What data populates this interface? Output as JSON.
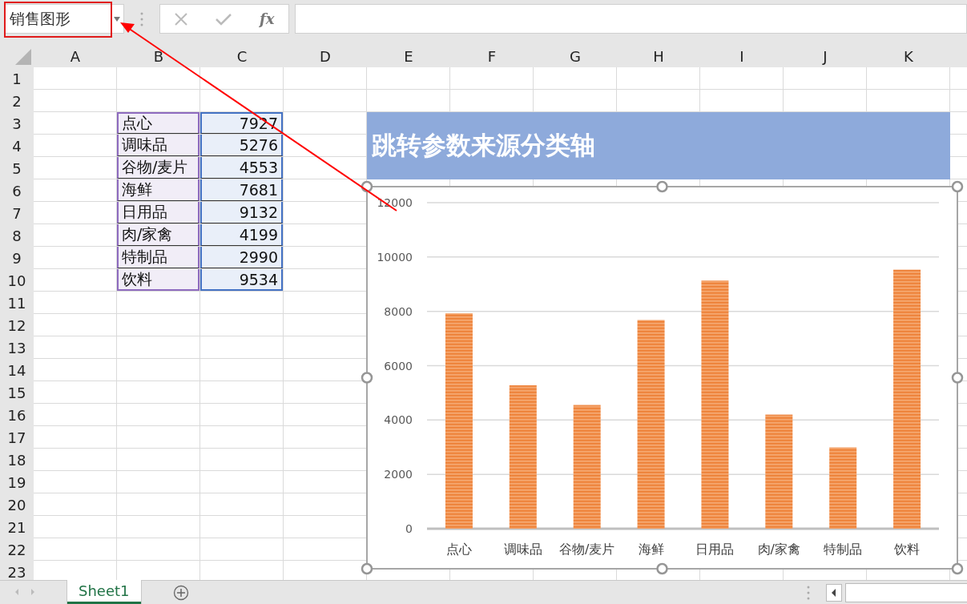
{
  "name_box": {
    "value": "销售图形"
  },
  "formula_bar": {
    "function_label": "fx"
  },
  "columns": [
    "A",
    "B",
    "C",
    "D",
    "E",
    "F",
    "G",
    "H",
    "I",
    "J",
    "K"
  ],
  "rows": [
    {
      "header": "1"
    },
    {
      "header": "2"
    },
    {
      "header": "3",
      "category": "点心",
      "value": "7927"
    },
    {
      "header": "4",
      "category": "调味品",
      "value": "5276"
    },
    {
      "header": "5",
      "category": "谷物/麦片",
      "value": "4553"
    },
    {
      "header": "6",
      "category": "海鲜",
      "value": "7681"
    },
    {
      "header": "7",
      "category": "日用品",
      "value": "9132"
    },
    {
      "header": "8",
      "category": "肉/家禽",
      "value": "4199"
    },
    {
      "header": "9",
      "category": "特制品",
      "value": "2990"
    },
    {
      "header": "10",
      "category": "饮料",
      "value": "9534"
    },
    {
      "header": "11"
    },
    {
      "header": "12"
    },
    {
      "header": "13"
    },
    {
      "header": "14"
    },
    {
      "header": "15"
    },
    {
      "header": "16"
    },
    {
      "header": "17"
    },
    {
      "header": "18"
    },
    {
      "header": "19"
    },
    {
      "header": "20"
    },
    {
      "header": "21"
    },
    {
      "header": "22"
    },
    {
      "header": "23"
    }
  ],
  "title_shape": {
    "text": "跳转参数来源分类轴"
  },
  "chart": {
    "selected": true,
    "chart_data": {
      "type": "bar",
      "grid": true,
      "categories": [
        "点心",
        "调味品",
        "谷物/麦片",
        "海鲜",
        "日用品",
        "肉/家禽",
        "特制品",
        "饮料"
      ],
      "series": [
        {
          "color": "#f4a268",
          "values": [
            7927,
            5276,
            4553,
            7681,
            9132,
            4199,
            2990,
            9534
          ]
        }
      ],
      "ylim": [
        0,
        12000
      ],
      "yticks": [
        0,
        2000,
        4000,
        6000,
        8000,
        10000,
        12000
      ]
    }
  },
  "sheet_tabs": [
    {
      "label": "Sheet1",
      "selected": true
    }
  ]
}
